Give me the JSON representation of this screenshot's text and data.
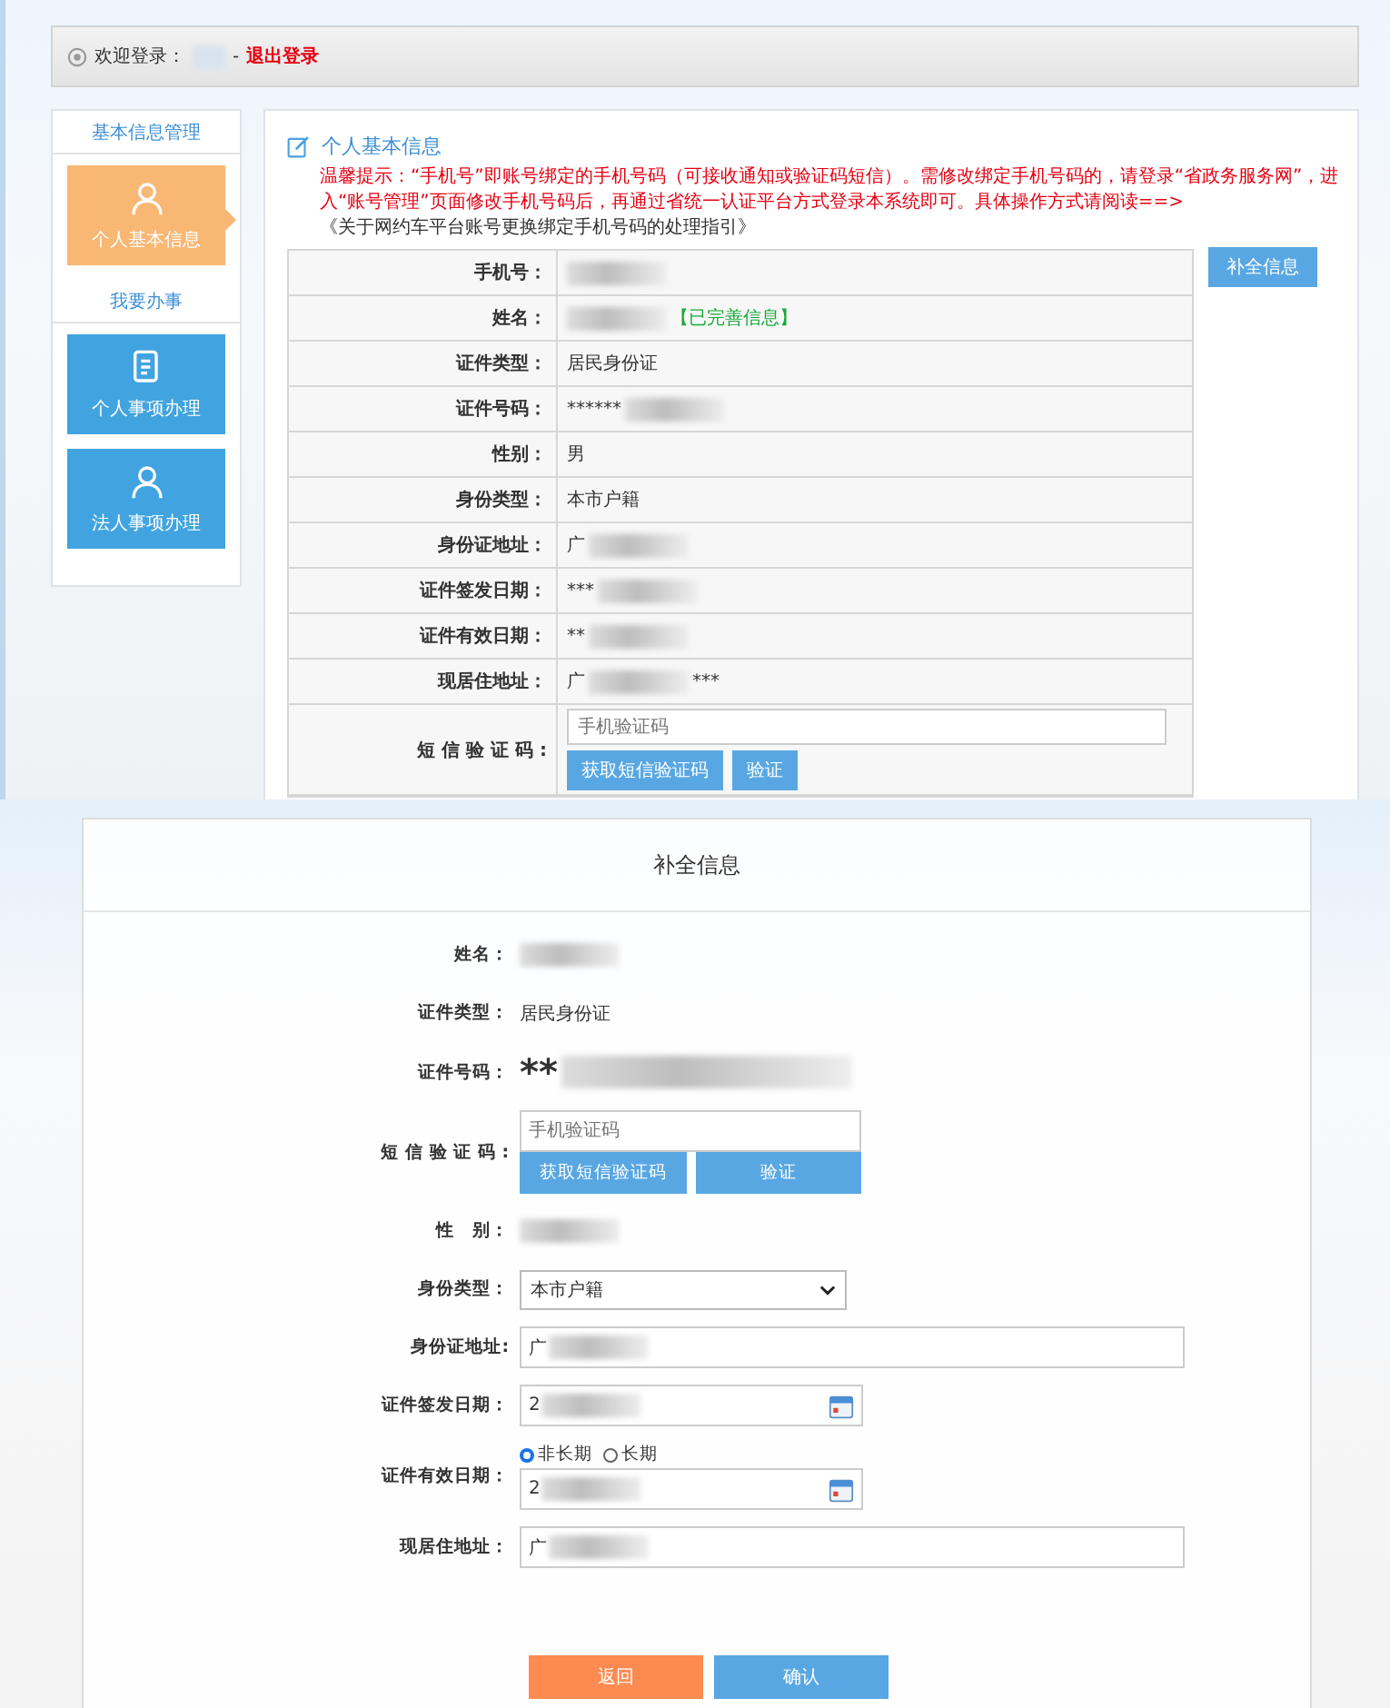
{
  "top": {
    "header": {
      "welcome": "欢迎登录：",
      "separator": "-",
      "logout": "退出登录"
    },
    "sidebar": [
      {
        "title": "基本信息管理",
        "items": [
          {
            "label": "个人基本信息",
            "kind": "person",
            "selected": true
          }
        ]
      },
      {
        "title": "我要办事",
        "items": [
          {
            "label": "个人事项办理",
            "kind": "document",
            "selected": false
          },
          {
            "label": "法人事项办理",
            "kind": "person",
            "selected": false
          }
        ]
      }
    ],
    "main": {
      "title": "个人基本信息",
      "notice": "温馨提示：“手机号”即账号绑定的手机号码（可接收通知或验证码短信）。需修改绑定手机号码的，请登录“省政务服务网”，进入“账号管理”页面修改手机号码后，再通过省统一认证平台方式登录本系统即可。具体操作方式请阅读==>",
      "notice_link": "《关于网约车平台账号更换绑定手机号码的处理指引》",
      "action_button": "补全信息",
      "rows": [
        {
          "kind": "text",
          "label": "手机号：",
          "redacted": true
        },
        {
          "kind": "text",
          "label": "姓名：",
          "redacted": true,
          "badge": "【已完善信息】"
        },
        {
          "kind": "text",
          "label": "证件类型：",
          "value": "居民身份证"
        },
        {
          "kind": "text",
          "label": "证件号码：",
          "value": "******",
          "redacted": true
        },
        {
          "kind": "text",
          "label": "性别：",
          "value": "男"
        },
        {
          "kind": "text",
          "label": "身份类型：",
          "value": "本市户籍"
        },
        {
          "kind": "text",
          "label": "身份证地址：",
          "value": "广",
          "redacted": true
        },
        {
          "kind": "text",
          "label": "证件签发日期：",
          "value": "***",
          "redacted": true
        },
        {
          "kind": "text",
          "label": "证件有效日期：",
          "value": "**",
          "redacted": true
        },
        {
          "kind": "text",
          "label": "现居住地址：",
          "value": "广",
          "redacted": true,
          "suffix": "***"
        },
        {
          "kind": "sms",
          "label": "短 信 验 证 码 :",
          "placeholder": "手机验证码",
          "buttons": [
            "获取短信验证码",
            "验证"
          ]
        }
      ]
    }
  },
  "dialog": {
    "title": "补全信息",
    "rows": [
      {
        "kind": "text",
        "label": "姓名：",
        "redacted": true
      },
      {
        "kind": "text",
        "label": "证件类型：",
        "value": "居民身份证"
      },
      {
        "kind": "bigtext",
        "label": "证件号码：",
        "value": "**",
        "redacted": true
      },
      {
        "kind": "sms",
        "label": "短 信 验 证 码 :",
        "placeholder": "手机验证码",
        "buttons": [
          "获取短信验证码",
          "验证"
        ]
      },
      {
        "kind": "text",
        "label": "性　别：",
        "redacted": true
      },
      {
        "kind": "select",
        "label": "身份类型：",
        "value": "本市户籍"
      },
      {
        "kind": "input",
        "label": "身份证地址:",
        "value": "广",
        "redacted": true
      },
      {
        "kind": "date",
        "label": "证件签发日期：",
        "value": "2",
        "redacted": true
      },
      {
        "kind": "date",
        "label": "证件有效日期：",
        "value": "2",
        "redacted": true,
        "options": [
          {
            "label": "非长期",
            "selected": true
          },
          {
            "label": "长期",
            "selected": false
          }
        ]
      },
      {
        "kind": "input",
        "label": "现居住地址：",
        "value": "广",
        "redacted": true
      }
    ],
    "buttons": [
      {
        "label": "返回",
        "kind": "back"
      },
      {
        "label": "确认",
        "kind": "confirm"
      }
    ]
  }
}
